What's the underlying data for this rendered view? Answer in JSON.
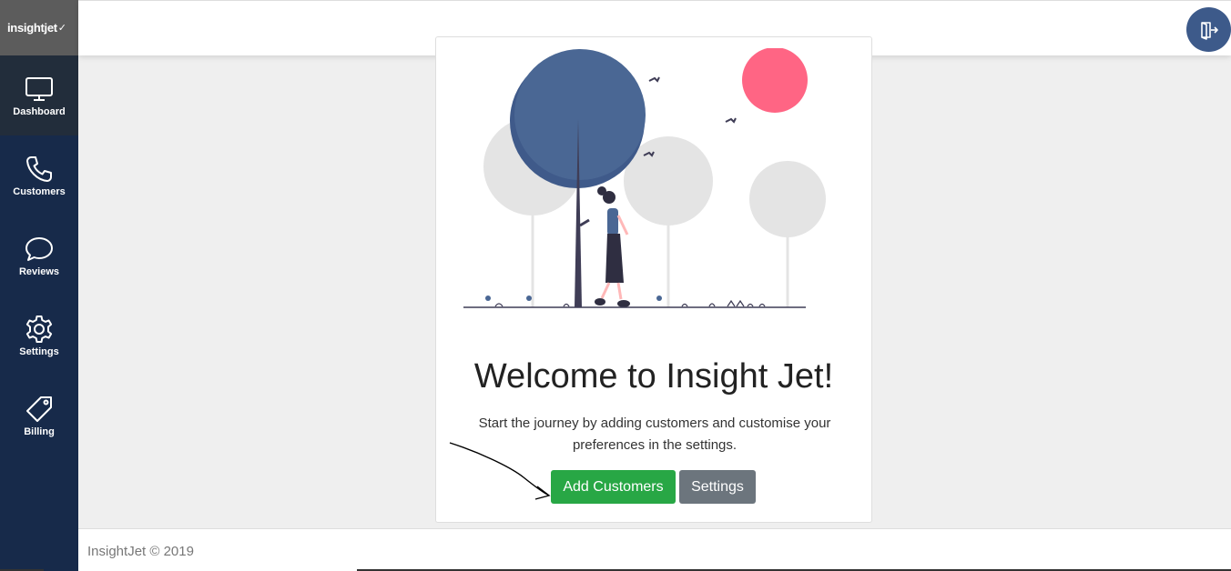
{
  "app": {
    "logo_text": "insightjet",
    "logo_mark": "✓"
  },
  "sidebar": {
    "items": [
      {
        "label": "Dashboard",
        "icon": "monitor-icon",
        "active": true
      },
      {
        "label": "Customers",
        "icon": "phone-icon",
        "active": false
      },
      {
        "label": "Reviews",
        "icon": "chat-bubble-icon",
        "active": false
      },
      {
        "label": "Settings",
        "icon": "gear-icon",
        "active": false
      },
      {
        "label": "Billing",
        "icon": "tag-icon",
        "active": false
      }
    ]
  },
  "header": {
    "logout_icon": "logout-icon"
  },
  "main": {
    "title": "Welcome to Insight Jet!",
    "subtitle": "Start the journey by adding customers and customise your preferences in the settings.",
    "add_customers_label": "Add Customers",
    "settings_label": "Settings"
  },
  "footer": {
    "text": "InsightJet © 2019"
  },
  "colors": {
    "sidebar": "#172a4a",
    "primary_button": "#28a745",
    "secondary_button": "#6c757d",
    "logout_button": "#3d5a8a"
  }
}
